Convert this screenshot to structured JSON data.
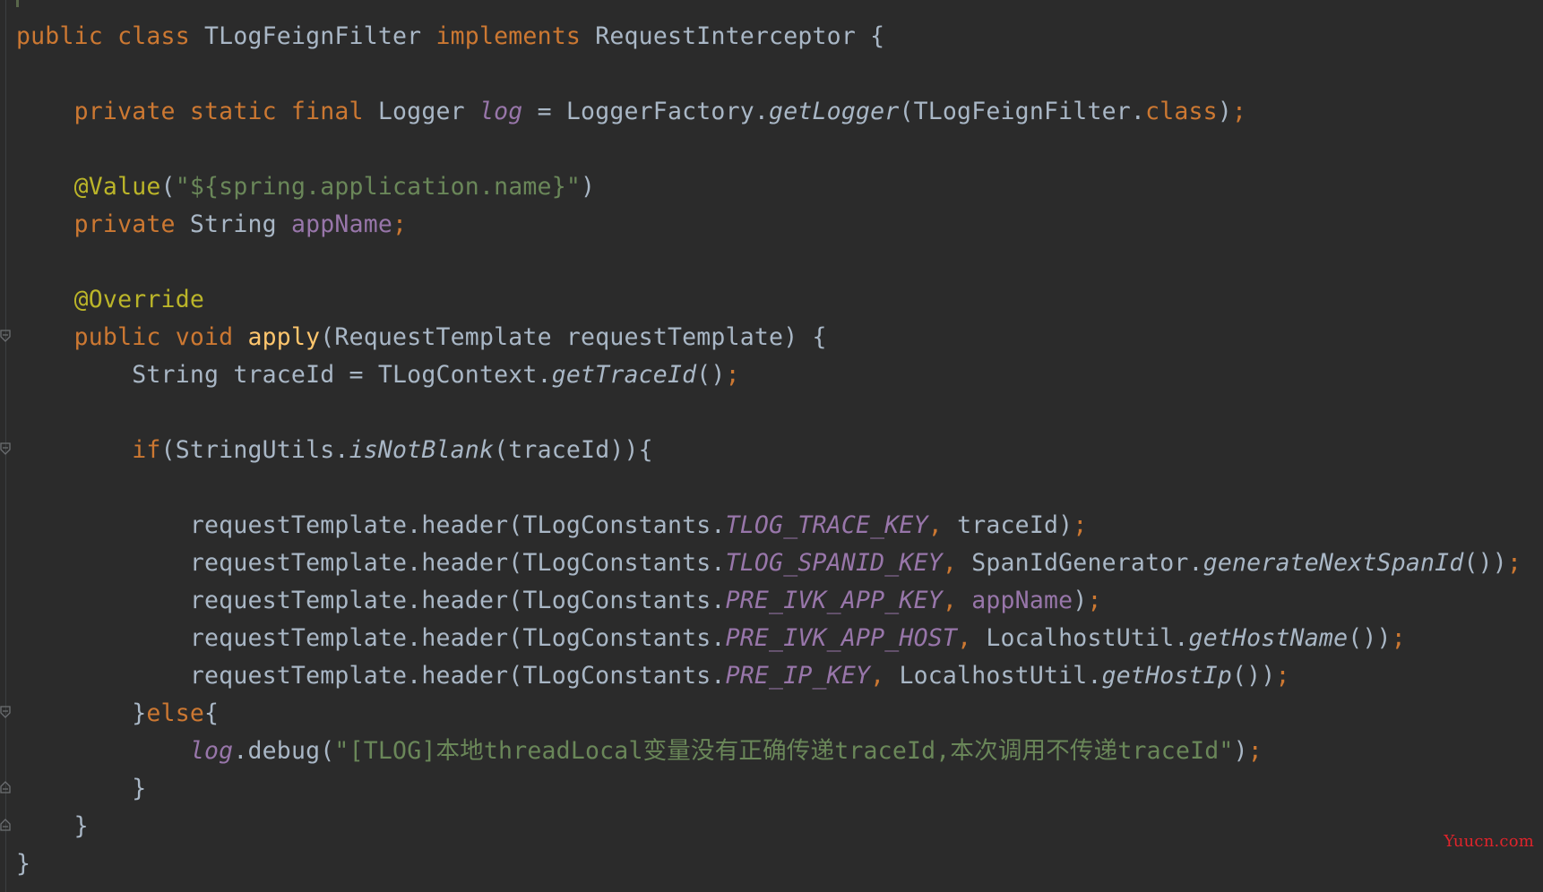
{
  "editor": {
    "language": "java",
    "theme_colors": {
      "background": "#2b2b2b",
      "default_text": "#a9b7c6",
      "keyword": "#cc7832",
      "annotation": "#bbb529",
      "string": "#6a8759",
      "field": "#9876aa",
      "method_declaration": "#ffc66d"
    },
    "lines": [
      [
        {
          "t": "public class ",
          "c": "kw"
        },
        {
          "t": "TLogFeignFilter ",
          "c": "txt"
        },
        {
          "t": "implements ",
          "c": "kw"
        },
        {
          "t": "RequestInterceptor {",
          "c": "txt"
        }
      ],
      [],
      [
        {
          "t": "    private static final ",
          "c": "kw"
        },
        {
          "t": "Logger ",
          "c": "txt"
        },
        {
          "t": "log",
          "c": "fld it"
        },
        {
          "t": " = LoggerFactory.",
          "c": "txt"
        },
        {
          "t": "getLogger",
          "c": "txt it"
        },
        {
          "t": "(TLogFeignFilter.",
          "c": "txt"
        },
        {
          "t": "class",
          "c": "kw"
        },
        {
          "t": ")",
          "c": "txt"
        },
        {
          "t": ";",
          "c": "kw"
        }
      ],
      [],
      [
        {
          "t": "    @Value",
          "c": "ann"
        },
        {
          "t": "(",
          "c": "txt"
        },
        {
          "t": "\"${spring.application.name}\"",
          "c": "str"
        },
        {
          "t": ")",
          "c": "txt"
        }
      ],
      [
        {
          "t": "    private ",
          "c": "kw"
        },
        {
          "t": "String ",
          "c": "txt"
        },
        {
          "t": "appName",
          "c": "fld"
        },
        {
          "t": ";",
          "c": "kw"
        }
      ],
      [],
      [
        {
          "t": "    @Override",
          "c": "ann"
        }
      ],
      [
        {
          "t": "    public void ",
          "c": "kw"
        },
        {
          "t": "apply",
          "c": "fn"
        },
        {
          "t": "(RequestTemplate requestTemplate) {",
          "c": "txt"
        }
      ],
      [
        {
          "t": "        String traceId = TLogContext.",
          "c": "txt"
        },
        {
          "t": "getTraceId",
          "c": "txt it"
        },
        {
          "t": "()",
          "c": "txt"
        },
        {
          "t": ";",
          "c": "kw"
        }
      ],
      [],
      [
        {
          "t": "        if",
          "c": "kw"
        },
        {
          "t": "(StringUtils.",
          "c": "txt"
        },
        {
          "t": "isNotBlank",
          "c": "txt it"
        },
        {
          "t": "(traceId)){",
          "c": "txt"
        }
      ],
      [],
      [
        {
          "t": "            requestTemplate.header(TLogConstants.",
          "c": "txt"
        },
        {
          "t": "TLOG_TRACE_KEY",
          "c": "fld it"
        },
        {
          "t": ", ",
          "c": "kw"
        },
        {
          "t": "traceId)",
          "c": "txt"
        },
        {
          "t": ";",
          "c": "kw"
        }
      ],
      [
        {
          "t": "            requestTemplate.header(TLogConstants.",
          "c": "txt"
        },
        {
          "t": "TLOG_SPANID_KEY",
          "c": "fld it"
        },
        {
          "t": ", ",
          "c": "kw"
        },
        {
          "t": "SpanIdGenerator.",
          "c": "txt"
        },
        {
          "t": "generateNextSpanId",
          "c": "txt it"
        },
        {
          "t": "())",
          "c": "txt"
        },
        {
          "t": ";",
          "c": "kw"
        }
      ],
      [
        {
          "t": "            requestTemplate.header(TLogConstants.",
          "c": "txt"
        },
        {
          "t": "PRE_IVK_APP_KEY",
          "c": "fld it"
        },
        {
          "t": ", ",
          "c": "kw"
        },
        {
          "t": "appName",
          "c": "fld"
        },
        {
          "t": ")",
          "c": "txt"
        },
        {
          "t": ";",
          "c": "kw"
        }
      ],
      [
        {
          "t": "            requestTemplate.header(TLogConstants.",
          "c": "txt"
        },
        {
          "t": "PRE_IVK_APP_HOST",
          "c": "fld it"
        },
        {
          "t": ", ",
          "c": "kw"
        },
        {
          "t": "LocalhostUtil.",
          "c": "txt"
        },
        {
          "t": "getHostName",
          "c": "txt it"
        },
        {
          "t": "())",
          "c": "txt"
        },
        {
          "t": ";",
          "c": "kw"
        }
      ],
      [
        {
          "t": "            requestTemplate.header(TLogConstants.",
          "c": "txt"
        },
        {
          "t": "PRE_IP_KEY",
          "c": "fld it"
        },
        {
          "t": ", ",
          "c": "kw"
        },
        {
          "t": "LocalhostUtil.",
          "c": "txt"
        },
        {
          "t": "getHostIp",
          "c": "txt it"
        },
        {
          "t": "())",
          "c": "txt"
        },
        {
          "t": ";",
          "c": "kw"
        }
      ],
      [
        {
          "t": "        }",
          "c": "txt"
        },
        {
          "t": "else",
          "c": "kw"
        },
        {
          "t": "{",
          "c": "txt"
        }
      ],
      [
        {
          "t": "            ",
          "c": "txt"
        },
        {
          "t": "log",
          "c": "fld it"
        },
        {
          "t": ".debug(",
          "c": "txt"
        },
        {
          "t": "\"[TLOG]本地threadLocal变量没有正确传递traceId,本次调用不传递traceId\"",
          "c": "str"
        },
        {
          "t": ")",
          "c": "txt"
        },
        {
          "t": ";",
          "c": "kw"
        }
      ],
      [
        {
          "t": "        }",
          "c": "txt"
        }
      ],
      [
        {
          "t": "    }",
          "c": "txt"
        }
      ],
      [
        {
          "t": "}",
          "c": "txt"
        }
      ]
    ]
  },
  "watermark": {
    "text": "Yuucn.com",
    "color": "#e0242b"
  }
}
